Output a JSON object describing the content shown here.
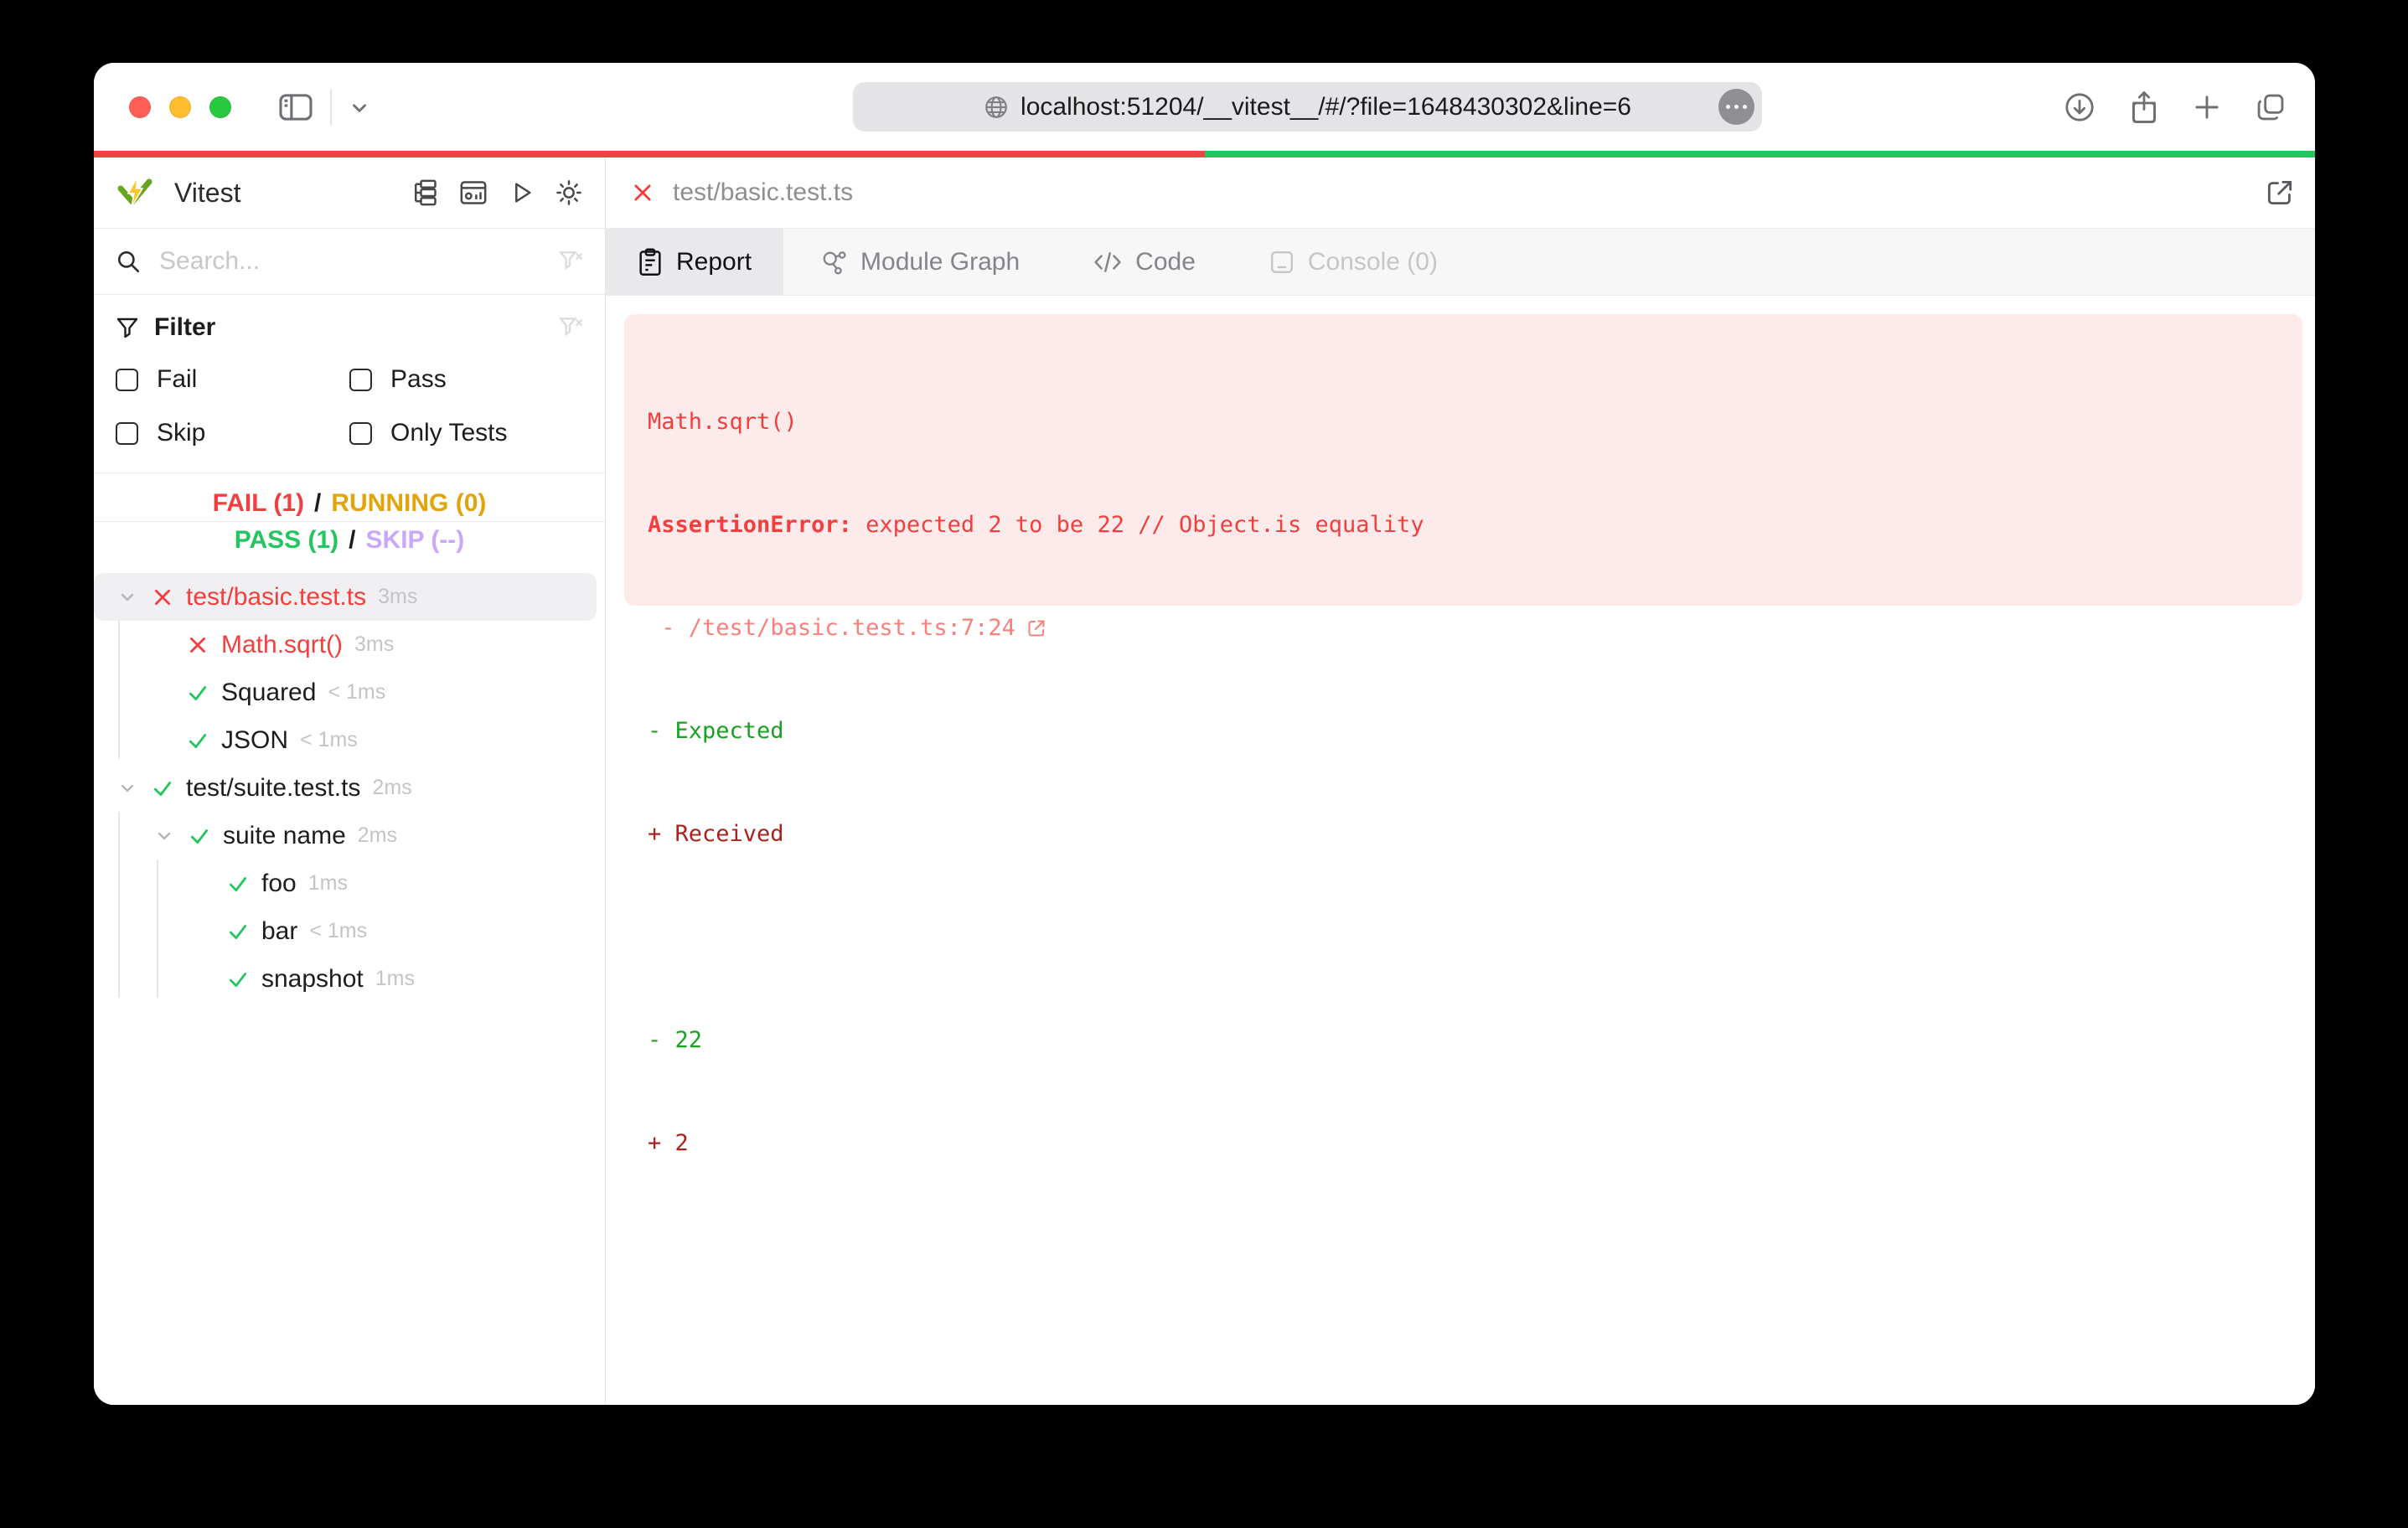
{
  "colors": {
    "fail_red": "#ef4444",
    "pass_green": "#22c55e",
    "running_yellow": "#e2a408",
    "skip_purple": "#c9a7fa",
    "error_text_red": "#f43e3e",
    "error_location_red": "#f8807a",
    "diff_expected_green": "#1aa022",
    "diff_received_red": "#a8231c",
    "error_panel_bg": "#fcebea"
  },
  "browser": {
    "url": "localhost:51204/__vitest__/#/?file=1648430302&line=6"
  },
  "sidebar": {
    "title": "Vitest",
    "search_placeholder": "Search...",
    "filter": {
      "title": "Filter",
      "fail": "Fail",
      "pass": "Pass",
      "skip": "Skip",
      "only_tests": "Only Tests"
    },
    "status": {
      "fail": "FAIL (1)",
      "sep1": "/",
      "running": "RUNNING (0)",
      "pass": "PASS (1)",
      "sep2": "/",
      "skip": "SKIP (--)"
    },
    "tree": {
      "items": [
        {
          "label": "test/basic.test.ts",
          "time": "3ms",
          "status": "fail"
        },
        {
          "label": "Math.sqrt()",
          "time": "3ms",
          "status": "fail"
        },
        {
          "label": "Squared",
          "time": "< 1ms",
          "status": "pass"
        },
        {
          "label": "JSON",
          "time": "< 1ms",
          "status": "pass"
        },
        {
          "label": "test/suite.test.ts",
          "time": "2ms",
          "status": "pass"
        },
        {
          "label": "suite name",
          "time": "2ms",
          "status": "pass"
        },
        {
          "label": "foo",
          "time": "1ms",
          "status": "pass"
        },
        {
          "label": "bar",
          "time": "< 1ms",
          "status": "pass"
        },
        {
          "label": "snapshot",
          "time": "1ms",
          "status": "pass"
        }
      ]
    }
  },
  "main": {
    "header": {
      "file": "test/basic.test.ts"
    },
    "tabs": {
      "report": "Report",
      "module_graph": "Module Graph",
      "code": "Code",
      "console": "Console (0)"
    },
    "error": {
      "title": "Math.sqrt()",
      "name": "AssertionError:",
      "message": " expected 2 to be 22 // Object.is equality",
      "location_prefix": " - ",
      "location": "/test/basic.test.ts:7:24",
      "expected_label": "- Expected",
      "received_label": "+ Received",
      "expected_value": "- 22",
      "received_value": "+ 2"
    }
  }
}
